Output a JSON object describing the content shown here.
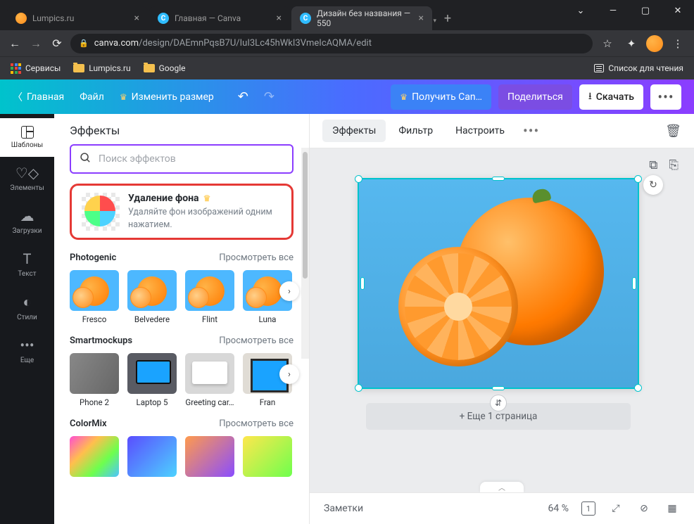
{
  "browser": {
    "tabs": [
      {
        "title": "Lumpics.ru"
      },
      {
        "title": "Главная — Canva"
      },
      {
        "title": "Дизайн без названия — 550"
      }
    ],
    "url_host": "canva.com",
    "url_path": "/design/DAEmnPqsB7U/IuI3Lc45hWkI3VmeIcAQMA/edit",
    "bookmarks": {
      "services": "Сервисы",
      "lumpics": "Lumpics.ru",
      "google": "Google",
      "reading": "Список для чтения"
    }
  },
  "toolbar": {
    "home": "Главная",
    "file": "Файл",
    "resize": "Изменить размер",
    "get_pro": "Получить Can…",
    "share": "Поделиться",
    "download": "Скачать"
  },
  "nav": {
    "templates": "Шаблоны",
    "elements": "Элементы",
    "uploads": "Загрузки",
    "text": "Текст",
    "styles": "Стили",
    "more": "Еще"
  },
  "panel": {
    "title": "Эффекты",
    "search_placeholder": "Поиск эффектов",
    "bg_remove": {
      "title": "Удаление фона",
      "desc": "Удаляйте фон изображений одним нажатием."
    },
    "see_all": "Просмотреть все",
    "sect1": {
      "title": "Photogenic",
      "items": [
        "Fresco",
        "Belvedere",
        "Flint",
        "Luna"
      ]
    },
    "sect2": {
      "title": "Smartmockups",
      "items": [
        "Phone 2",
        "Laptop 5",
        "Greeting car…",
        "Fran"
      ]
    },
    "sect3": {
      "title": "ColorMix"
    }
  },
  "ctx": {
    "effects": "Эффекты",
    "filter": "Фильтр",
    "adjust": "Настроить"
  },
  "stage": {
    "add_page": "+ Еще 1 страница"
  },
  "footer": {
    "notes": "Заметки",
    "zoom": "64 %",
    "page": "1"
  }
}
